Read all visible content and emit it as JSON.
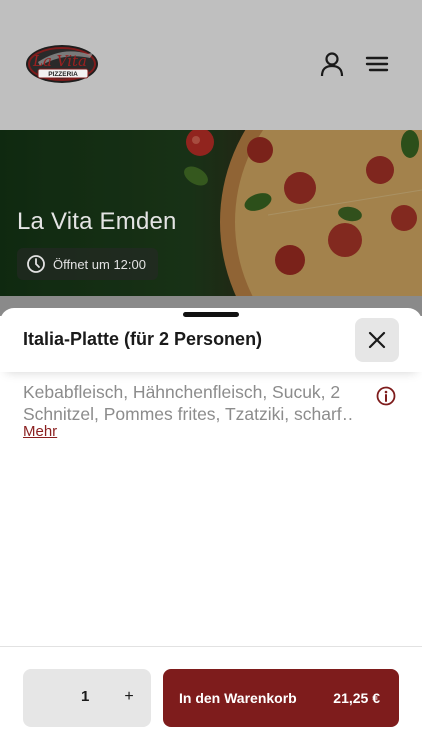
{
  "header": {
    "logo_script": "La Vita",
    "logo_banner": "PIZZERIA",
    "account_icon": "user-icon",
    "menu_icon": "hamburger-menu-icon"
  },
  "hero": {
    "restaurant_name": "La Vita Emden",
    "opening_text": "Öffnet um 12:00",
    "clock_icon": "clock-icon"
  },
  "sheet": {
    "title": "Italia-Platte (für 2 Personen)",
    "close_icon": "close-icon",
    "description_line1": "Kebabfleisch, Hähnchenfleisch, Sucuk, 2",
    "description_line2": "Schnitzel, Pommes frites, Tzatziki, scharf…",
    "more_label": "Mehr",
    "info_icon": "info-icon"
  },
  "footer": {
    "quantity": "1",
    "plus_label": "+",
    "add_to_cart_label": "In den Warenkorb",
    "price": "21,25 €"
  },
  "colors": {
    "brand": "#7e1c1c",
    "header_bg": "#bfbfbf",
    "button_bg": "#e6e6e6"
  }
}
